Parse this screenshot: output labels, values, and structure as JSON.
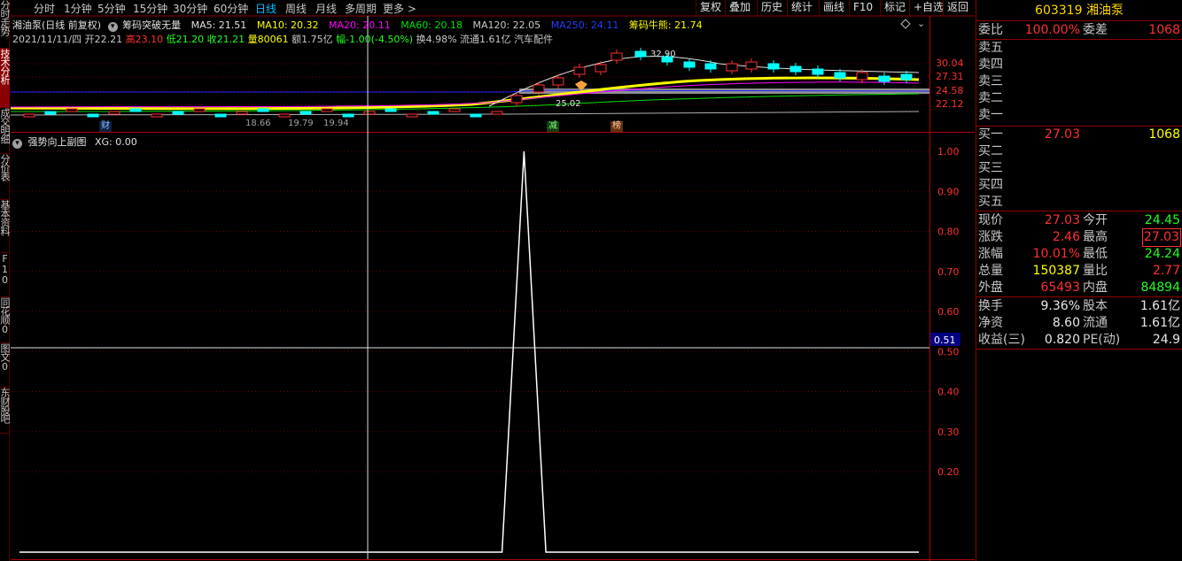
{
  "left_tabs": [
    {
      "label": "分时走势",
      "active": false
    },
    {
      "label": "技术分析",
      "active": true
    },
    {
      "label": "成交明细",
      "active": false
    },
    {
      "label": "分价表",
      "active": false
    },
    {
      "label": "基本资料",
      "active": false
    },
    {
      "label": "F10",
      "active": false
    },
    {
      "label": "同花顺0",
      "active": false
    },
    {
      "label": "图文0",
      "active": false
    },
    {
      "label": "东财股吧",
      "active": false
    }
  ],
  "periods": [
    "分时",
    "1分钟",
    "5分钟",
    "15分钟",
    "30分钟",
    "60分钟",
    "日线",
    "周线",
    "月线",
    "多周期",
    "更多 >"
  ],
  "active_period": "日线",
  "toolbar_buttons": [
    "复权",
    "叠加",
    "历史",
    "统计",
    "画线",
    "F10",
    "标记",
    "+自选",
    "返回"
  ],
  "header": {
    "stock_name": "湘油泵(日线 前复权)",
    "indicator": "筹码突破无量",
    "ma5": "MA5: 21.51",
    "ma10": "MA10: 20.32",
    "ma20": "MA20: 20.11",
    "ma60": "MA60: 20.18",
    "ma120": "MA120: 22.05",
    "ma250": "MA250: 24.11",
    "chip": "筹码牛熊: 21.74",
    "date": "2021/11/11/四",
    "open": "开22.21",
    "high": "高23.10",
    "low": "低21.20",
    "close": "收21.21",
    "volume": "量80061",
    "amount": "额1.75亿",
    "change": "幅-1.00(-4.50%)",
    "turnover": "换4.98%",
    "float": "流通1.61亿",
    "industry": "汽车配件"
  },
  "main_price_labels": [
    "30.04",
    "27.31",
    "24.58",
    "22.12"
  ],
  "main_annotations": {
    "high": "32.90",
    "mid": "25.02",
    "low1": "18.66",
    "low2": "19.79",
    "low3": "19.94"
  },
  "markers": {
    "cai": "财",
    "jian": "减",
    "bang": "榜"
  },
  "sub_chart": {
    "title": "强势向上副图",
    "xg_label": "XG: 0.00",
    "y_labels": [
      "1.00",
      "0.90",
      "0.80",
      "0.70",
      "0.60",
      "0.50",
      "0.40",
      "0.30",
      "0.20"
    ],
    "cursor_value": "0.51"
  },
  "chart_data": {
    "type": "line",
    "title": "强势向上副图",
    "series": [
      {
        "name": "XG",
        "values": [
          0,
          0,
          0,
          0,
          0,
          0,
          0,
          0,
          0,
          0,
          0,
          0,
          0,
          0,
          0,
          0,
          0,
          0,
          0,
          0,
          0,
          0,
          0,
          1,
          0,
          0,
          0,
          0,
          0,
          0,
          0,
          0,
          0,
          0,
          0,
          0,
          0,
          0,
          0,
          0,
          0,
          0
        ]
      }
    ],
    "ylim": [
      0,
      1.05
    ],
    "y_ticks": [
      1.0,
      0.9,
      0.8,
      0.7,
      0.6,
      0.5,
      0.4,
      0.3,
      0.2
    ],
    "grid": true
  },
  "quote": {
    "code_name": "603319 湘油泵",
    "weibi_label": "委比",
    "weibi": "100.00%",
    "weicha_label": "委差",
    "weicha": "1068",
    "sell": [
      "卖五",
      "卖四",
      "卖三",
      "卖二",
      "卖一"
    ],
    "buy": [
      {
        "label": "买一",
        "price": "27.03",
        "vol": "1068"
      },
      {
        "label": "买二",
        "price": "",
        "vol": ""
      },
      {
        "label": "买三",
        "price": "",
        "vol": ""
      },
      {
        "label": "买四",
        "price": "",
        "vol": ""
      },
      {
        "label": "买五",
        "price": "",
        "vol": ""
      }
    ],
    "stats": [
      {
        "k1": "现价",
        "v1": "27.03",
        "c1": "red",
        "k2": "今开",
        "v2": "24.45",
        "c2": "grn"
      },
      {
        "k1": "涨跌",
        "v1": "2.46",
        "c1": "red",
        "k2": "最高",
        "v2": "27.03",
        "c2": "red boxed"
      },
      {
        "k1": "涨幅",
        "v1": "10.01%",
        "c1": "red",
        "k2": "最低",
        "v2": "24.24",
        "c2": "grn"
      },
      {
        "k1": "总量",
        "v1": "150387",
        "c1": "yel",
        "k2": "量比",
        "v2": "2.77",
        "c2": "red"
      },
      {
        "k1": "外盘",
        "v1": "65493",
        "c1": "red",
        "k2": "内盘",
        "v2": "84894",
        "c2": "grn"
      }
    ],
    "fund": [
      {
        "k1": "换手",
        "v1": "9.36%",
        "k2": "股本",
        "v2": "1.61亿"
      },
      {
        "k1": "净资",
        "v1": "8.60",
        "k2": "流通",
        "v2": "1.61亿"
      },
      {
        "k1": "收益(三)",
        "v1": "0.820",
        "k2": "PE(动)",
        "v2": "24.9"
      }
    ]
  }
}
